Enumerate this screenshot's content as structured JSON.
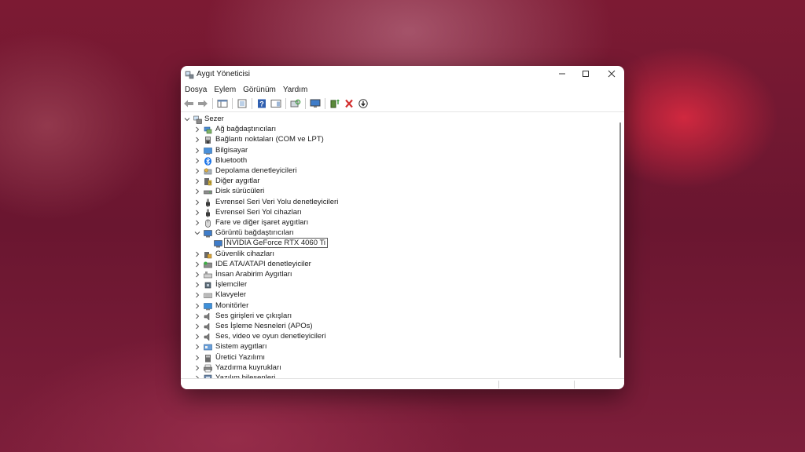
{
  "window": {
    "title": "Aygıt Yöneticisi",
    "minimize_icon": "minimize-icon",
    "maximize_icon": "maximize-icon",
    "close_icon": "close-icon"
  },
  "menu": [
    "Dosya",
    "Eylem",
    "Görünüm",
    "Yardım"
  ],
  "toolbar": {
    "icons": [
      "back-arrow-icon",
      "forward-arrow-icon",
      "show-hide-console-tree-icon",
      "properties-icon",
      "help-icon",
      "action-pane-icon",
      "scan-hardware-icon",
      "monitor-icon",
      "update-driver-icon",
      "uninstall-device-icon",
      "disable-device-icon"
    ]
  },
  "tree": {
    "root": "Sezer",
    "categories": [
      {
        "label": "Ağ bağdaştırıcıları",
        "icon": "network-adapter-icon",
        "expanded": false
      },
      {
        "label": "Bağlantı noktaları (COM ve LPT)",
        "icon": "port-icon",
        "expanded": false
      },
      {
        "label": "Bilgisayar",
        "icon": "computer-icon",
        "expanded": false
      },
      {
        "label": "Bluetooth",
        "icon": "bluetooth-icon",
        "expanded": false
      },
      {
        "label": "Depolama denetleyicileri",
        "icon": "storage-controller-icon",
        "expanded": false
      },
      {
        "label": "Diğer aygıtlar",
        "icon": "other-devices-icon",
        "expanded": false
      },
      {
        "label": "Disk sürücüleri",
        "icon": "disk-drive-icon",
        "expanded": false
      },
      {
        "label": "Evrensel Seri Veri Yolu denetleyicileri",
        "icon": "usb-icon",
        "expanded": false
      },
      {
        "label": "Evrensel Seri Yol cihazları",
        "icon": "usb-icon",
        "expanded": false
      },
      {
        "label": "Fare ve diğer işaret aygıtları",
        "icon": "mouse-icon",
        "expanded": false
      },
      {
        "label": "Görüntü bağdaştırıcıları",
        "icon": "display-adapter-icon",
        "expanded": true,
        "children": [
          {
            "label": "NVIDIA GeForce RTX 4060 Ti",
            "icon": "display-adapter-icon",
            "selected": true
          }
        ]
      },
      {
        "label": "Güvenlik cihazları",
        "icon": "security-device-icon",
        "expanded": false
      },
      {
        "label": "IDE ATA/ATAPI denetleyiciler",
        "icon": "ide-controller-icon",
        "expanded": false
      },
      {
        "label": "İnsan Arabirim Aygıtları",
        "icon": "hid-icon",
        "expanded": false
      },
      {
        "label": "İşlemciler",
        "icon": "processor-icon",
        "expanded": false
      },
      {
        "label": "Klavyeler",
        "icon": "keyboard-icon",
        "expanded": false
      },
      {
        "label": "Monitörler",
        "icon": "monitor-icon",
        "expanded": false
      },
      {
        "label": "Ses girişleri ve çıkışları",
        "icon": "speaker-icon",
        "expanded": false
      },
      {
        "label": "Ses İşleme Nesneleri (APOs)",
        "icon": "speaker-icon",
        "expanded": false
      },
      {
        "label": "Ses, video ve oyun denetleyicileri",
        "icon": "speaker-icon",
        "expanded": false
      },
      {
        "label": "Sistem aygıtları",
        "icon": "system-device-icon",
        "expanded": false
      },
      {
        "label": "Üretici Yazılımı",
        "icon": "firmware-icon",
        "expanded": false
      },
      {
        "label": "Yazdırma kuyrukları",
        "icon": "printer-icon",
        "expanded": false
      },
      {
        "label": "Yazılım bileşenleri",
        "icon": "software-component-icon",
        "expanded": false
      }
    ]
  },
  "colors": {
    "background": "#6a1630",
    "accent_red": "#d0283f",
    "bluetooth_blue": "#1a73e8",
    "delete_red": "#d32f2f"
  }
}
